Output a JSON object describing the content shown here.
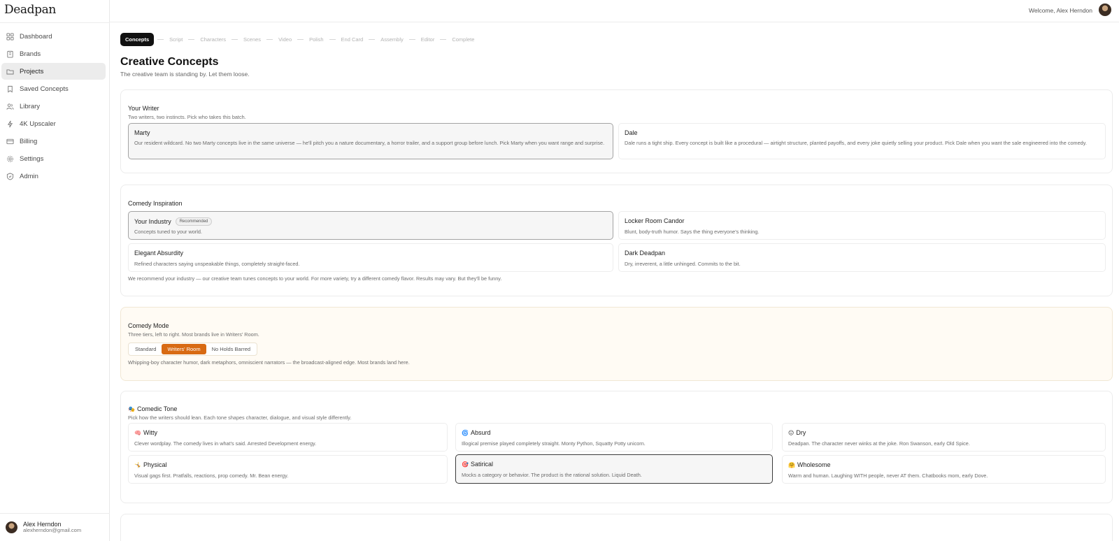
{
  "app": {
    "logo": "Deadpan",
    "welcome": "Welcome, Alex Herndon"
  },
  "sidebar": {
    "items": [
      {
        "label": "Dashboard",
        "icon": "grid-icon"
      },
      {
        "label": "Brands",
        "icon": "building-icon"
      },
      {
        "label": "Projects",
        "icon": "folder-icon",
        "active": true
      },
      {
        "label": "Saved Concepts",
        "icon": "bookmark-icon"
      },
      {
        "label": "Library",
        "icon": "users-icon"
      },
      {
        "label": "4K Upscaler",
        "icon": "sparkle-icon"
      },
      {
        "label": "Billing",
        "icon": "card-icon"
      },
      {
        "label": "Settings",
        "icon": "gear-icon"
      },
      {
        "label": "Admin",
        "icon": "shield-icon"
      }
    ],
    "user": {
      "name": "Alex Herndon",
      "email": "alexherndon@gmail.com"
    }
  },
  "steps": [
    "Concepts",
    "Script",
    "Characters",
    "Scenes",
    "Video",
    "Polish",
    "End Card",
    "Assembly",
    "Editor",
    "Complete"
  ],
  "page": {
    "title": "Creative Concepts",
    "subtitle": "The creative team is standing by. Let them loose."
  },
  "writer": {
    "title": "Your Writer",
    "subtitle": "Two writers, two instincts. Pick who takes this batch.",
    "options": [
      {
        "name": "Marty",
        "desc": "Our resident wildcard. No two Marty concepts live in the same universe — he'll pitch you a nature documentary, a horror trailer, and a support group before lunch. Pick Marty when you want range and surprise."
      },
      {
        "name": "Dale",
        "desc": "Dale runs a tight ship. Every concept is built like a procedural — airtight structure, planted payoffs, and every joke quietly selling your product. Pick Dale when you want the sale engineered into the comedy."
      }
    ]
  },
  "inspiration": {
    "title": "Comedy Inspiration",
    "options": [
      {
        "name": "Your Industry",
        "badge": "Recommended",
        "desc": "Concepts tuned to your world."
      },
      {
        "name": "Locker Room Candor",
        "desc": "Blunt, body-truth humor. Says the thing everyone's thinking."
      },
      {
        "name": "Elegant Absurdity",
        "desc": "Refined characters saying unspeakable things, completely straight-faced."
      },
      {
        "name": "Dark Deadpan",
        "desc": "Dry, irreverent, a little unhinged. Commits to the bit."
      }
    ],
    "note": "We recommend your industry — our creative team tunes concepts to your world. For more variety, try a different comedy flavor. Results may vary. But they'll be funny."
  },
  "mode": {
    "title": "Comedy Mode",
    "subtitle": "Three tiers, left to right. Most brands live in Writers' Room.",
    "options": [
      "Standard",
      "Writers' Room",
      "No Holds Barred"
    ],
    "selected": "Writers' Room",
    "note": "Whipping-boy character humor, dark metaphors, omniscient narrators — the broadcast-aligned edge. Most brands land here.",
    "accent": "#d86a13"
  },
  "tone": {
    "title": "Comedic Tone",
    "emoji": "🎭",
    "subtitle": "Pick how the writers should lean. Each tone shapes character, dialogue, and visual style differently.",
    "options": [
      {
        "emoji": "🧠",
        "name": "Witty",
        "desc": "Clever wordplay. The comedy lives in what's said. Arrested Development energy."
      },
      {
        "emoji": "🌀",
        "name": "Absurd",
        "desc": "Illogical premise played completely straight. Monty Python, Squatty Potty unicorn."
      },
      {
        "emoji": "😐",
        "name": "Dry",
        "desc": "Deadpan. The character never winks at the joke. Ron Swanson, early Old Spice."
      },
      {
        "emoji": "🤸",
        "name": "Physical",
        "desc": "Visual gags first. Pratfalls, reactions, prop comedy. Mr. Bean energy."
      },
      {
        "emoji": "🎯",
        "name": "Satirical",
        "desc": "Mocks a category or behavior. The product is the rational solution. Liquid Death."
      },
      {
        "emoji": "🤗",
        "name": "Wholesome",
        "desc": "Warm and human. Laughing WITH people, never AT them. Chatbooks mom, early Dove."
      }
    ]
  }
}
